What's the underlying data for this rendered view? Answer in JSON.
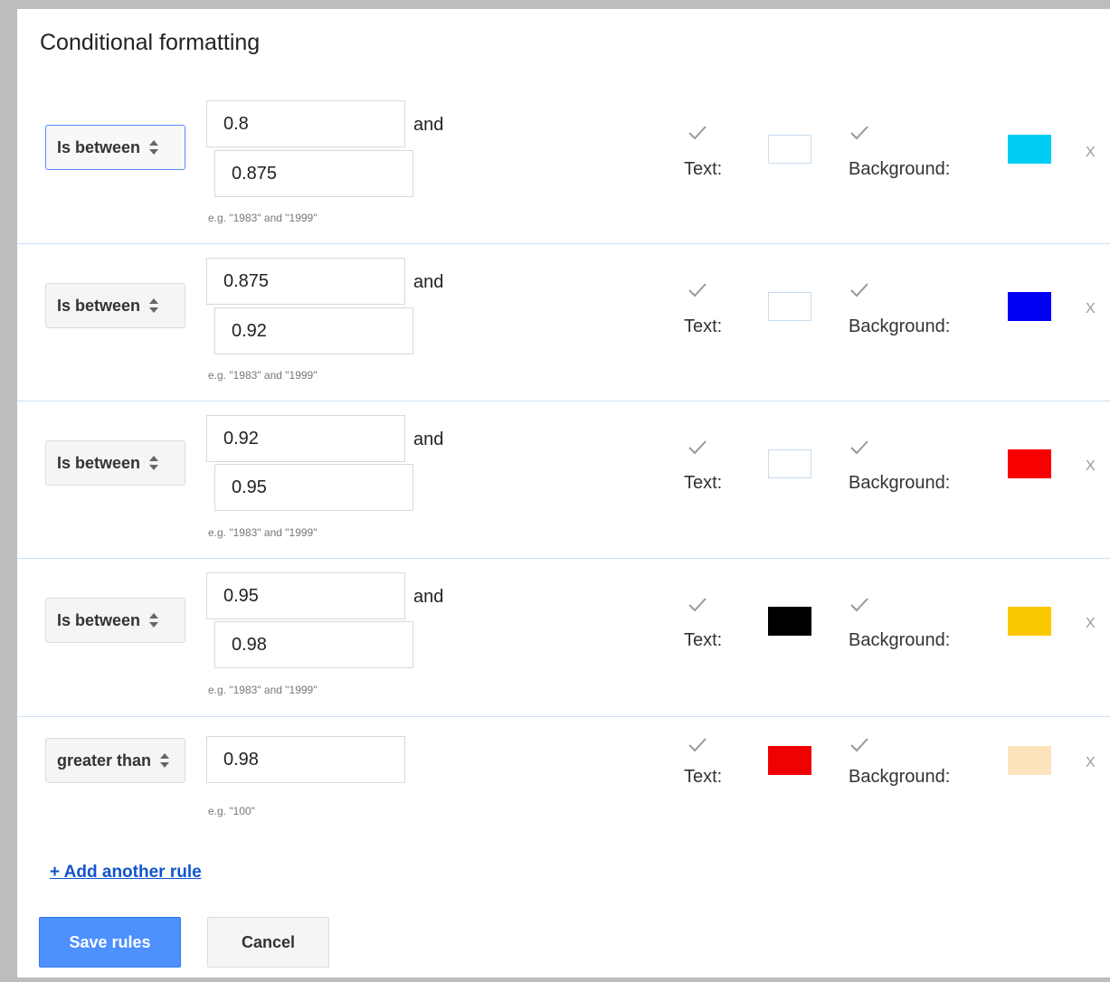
{
  "dialog": {
    "title": "Conditional formatting"
  },
  "rules": [
    {
      "condition": "Is between",
      "value1": "0.8",
      "value2": "0.875",
      "and_label": "and",
      "hint": "e.g. \"1983\" and \"1999\"",
      "text_label": "Text:",
      "text_color": "",
      "background_label": "Background:",
      "background_color": "#00ccf5",
      "remove": "X"
    },
    {
      "condition": "Is between",
      "value1": "0.875",
      "value2": "0.92",
      "and_label": "and",
      "hint": "e.g. \"1983\" and \"1999\"",
      "text_label": "Text:",
      "text_color": "",
      "background_label": "Background:",
      "background_color": "#0000f2",
      "remove": "X"
    },
    {
      "condition": "Is between",
      "value1": "0.92",
      "value2": "0.95",
      "and_label": "and",
      "hint": "e.g. \"1983\" and \"1999\"",
      "text_label": "Text:",
      "text_color": "",
      "background_label": "Background:",
      "background_color": "#f90000",
      "remove": "X"
    },
    {
      "condition": "Is between",
      "value1": "0.95",
      "value2": "0.98",
      "and_label": "and",
      "hint": "e.g. \"1983\" and \"1999\"",
      "text_label": "Text:",
      "text_color": "#000000",
      "background_label": "Background:",
      "background_color": "#f9c800",
      "remove": "X"
    },
    {
      "condition": "greater than",
      "value1": "0.98",
      "hint": "e.g. \"100\"",
      "text_label": "Text:",
      "text_color": "#f00000",
      "background_label": "Background:",
      "background_color": "#fde4bd",
      "remove": "X"
    }
  ],
  "add_rule_label": "+ Add another rule",
  "buttons": {
    "save": "Save rules",
    "cancel": "Cancel"
  },
  "icons": {
    "checkbox": "checkmark-icon",
    "select": "up-down-arrows-icon"
  }
}
